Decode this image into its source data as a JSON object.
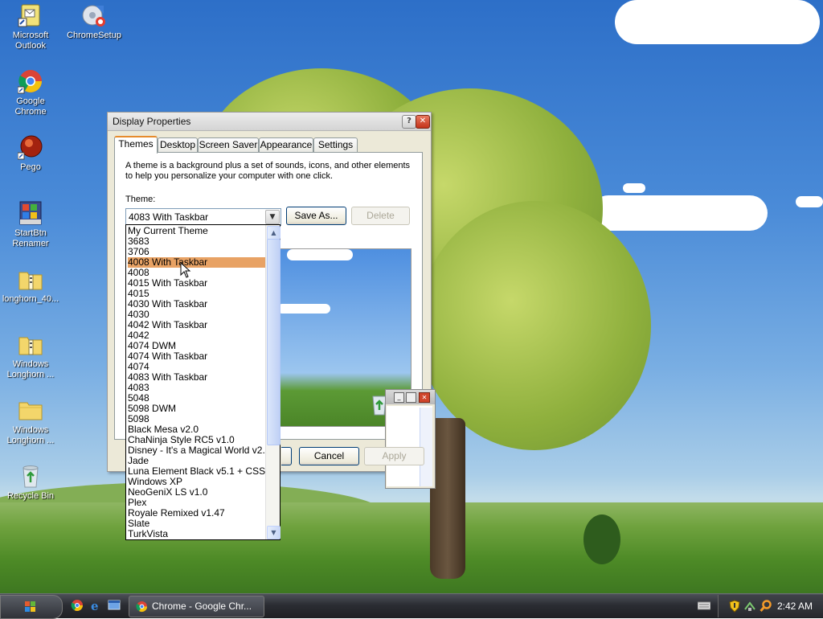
{
  "desktop_icons": [
    {
      "label_line1": "Microsoft",
      "label_line2": "Outlook"
    },
    {
      "label_line1": "ChromeSetup",
      "label_line2": ""
    },
    {
      "label_line1": "Google Chrome",
      "label_line2": ""
    },
    {
      "label_line1": "Pego",
      "label_line2": ""
    },
    {
      "label_line1": "StartBtn",
      "label_line2": "Renamer"
    },
    {
      "label_line1": "longhorn_40...",
      "label_line2": ""
    },
    {
      "label_line1": "Windows",
      "label_line2": "Longhorn ..."
    },
    {
      "label_line1": "Windows",
      "label_line2": "Longhorn ..."
    },
    {
      "label_line1": "Recycle Bin",
      "label_line2": ""
    }
  ],
  "window": {
    "title": "Display Properties",
    "help_glyph": "?",
    "close_glyph": "✕",
    "tabs": [
      "Themes",
      "Desktop",
      "Screen Saver",
      "Appearance",
      "Settings"
    ],
    "description_line1": "A theme is a background plus a set of sounds, icons, and other elements",
    "description_line2": "to help you personalize your computer with one click.",
    "theme_label": "Theme:",
    "theme_value": "4083 With Taskbar",
    "save_as": "Save As...",
    "delete": "Delete",
    "ok": "OK",
    "cancel": "Cancel",
    "apply": "Apply"
  },
  "dropdown": {
    "selected_index": 3,
    "items": [
      "My Current Theme",
      "3683",
      "3706",
      "4008 With Taskbar",
      "4008",
      "4015 With Taskbar",
      "4015",
      "4030 With Taskbar",
      "4030",
      "4042 With Taskbar",
      "4042",
      "4074 DWM",
      "4074 With Taskbar",
      "4074",
      "4083 With Taskbar",
      "4083",
      "5048",
      "5098 DWM",
      "5098",
      "Black Mesa v2.0",
      "ChaNinja Style RC5 v1.0",
      "Disney - It's a Magical World v2.0",
      "Jade",
      "Luna Element Black v5.1 + CSS",
      "Windows XP",
      "NeoGeniX LS v1.0",
      "Plex",
      "Royale Remixed v1.47",
      "Slate",
      "TurkVista"
    ]
  },
  "taskbar": {
    "task_label": "Chrome - Google Chr...",
    "clock": "2:42 AM"
  },
  "colors": {
    "selection": "#e8a264",
    "tab_highlight": "#e68b2c",
    "taskbar": "#2b2d33"
  }
}
